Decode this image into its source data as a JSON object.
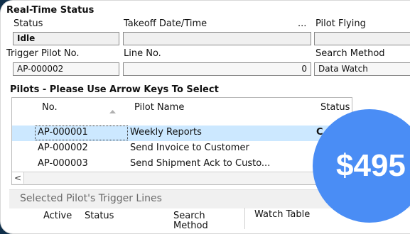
{
  "realtime": {
    "title": "Real-Time Status",
    "status_label": "Status",
    "status_value": "Idle",
    "takeoff_label": "Takeoff Date/Time",
    "ellipsis": "...",
    "pilot_flying_label": "Pilot Flying",
    "trigger_pilot_label": "Trigger Pilot No.",
    "trigger_pilot_value": "AP-000002",
    "line_label": "Line No.",
    "line_value": "0",
    "search_method_label": "Search Method",
    "search_method_value": "Data Watch"
  },
  "pilots": {
    "title": "Pilots - Please Use Arrow Keys To Select",
    "columns": {
      "no": "No.",
      "name": "Pilot Name",
      "status": "Status"
    },
    "rows": [
      {
        "no": "AP-000001",
        "name": "Weekly Reports",
        "status": "C",
        "selected": true
      },
      {
        "no": "AP-000002",
        "name": "Send Invoice to Customer",
        "status": ""
      },
      {
        "no": "AP-000003",
        "name": "Send Shipment Ack to Custo...",
        "status": ""
      }
    ],
    "scroll_left": "<"
  },
  "trigger_lines": {
    "title": "Selected Pilot's Trigger Lines",
    "columns": {
      "active": "Active",
      "status": "Status",
      "search_method_1": "Search",
      "search_method_2": "Method",
      "watch_table": "Watch Table"
    }
  },
  "promo": {
    "price": "$495",
    "color": "#4a8df5"
  }
}
